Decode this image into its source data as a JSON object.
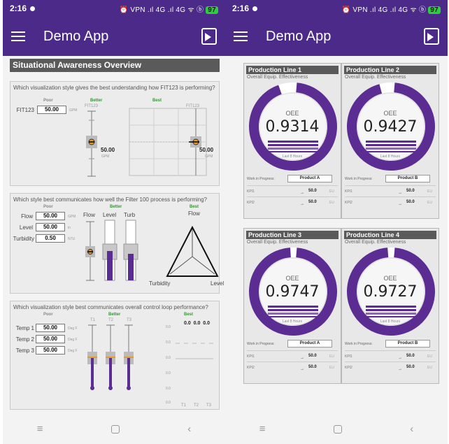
{
  "status": {
    "time": "2:16",
    "icons": "⏰ VPN .ıl 4G .ıl 4G ᯤ ⓑ",
    "battery": "97"
  },
  "app": {
    "title": "Demo App"
  },
  "left": {
    "header": "Situational Awareness Overview",
    "section1": {
      "question": "Which visualization style gives the best understanding how FIT123 is performing?",
      "poor": "Poor",
      "better": "Better",
      "best": "Best",
      "label": "FIT123",
      "value": "50.00",
      "unit": "GPM",
      "tag_better": "FIT123",
      "tag_best": "FIT123",
      "big_value": "50.00",
      "big_unit": "GPM",
      "best_value": "50.00",
      "best_unit": "GPM"
    },
    "section2": {
      "question": "Which style best communicates how well the Filter 100 process is performing?",
      "poor": "Poor",
      "better": "Better",
      "best": "Best",
      "flow_label": "Flow",
      "flow_value": "50.00",
      "flow_unit": "GPM",
      "level_label": "Level",
      "level_value": "50.00",
      "level_unit": "in",
      "turb_label": "Turbidity",
      "turb_value": "0.50",
      "turb_unit": "NTU",
      "col_flow": "Flow",
      "col_level": "Level",
      "col_turb": "Turb",
      "radar_top": "Flow",
      "radar_left": "Turbidity",
      "radar_right": "Level"
    },
    "section3": {
      "question": "Which visualization style best communicates overall control loop performance?",
      "poor": "Poor",
      "better": "Better",
      "best": "Best",
      "t1_label": "Temp 1",
      "t1_value": "50.00",
      "t2_label": "Temp 2",
      "t2_value": "50.00",
      "t3_label": "Temp 3",
      "t3_value": "50.00",
      "unit": "Deg F",
      "col_t1": "T1",
      "col_t2": "T2",
      "col_t3": "T3",
      "best_vals": "0.0  0.0  0.0",
      "axis_0": "0.0",
      "bottom_t1": "T1",
      "bottom_t2": "T2",
      "bottom_t3": "T3"
    }
  },
  "right": {
    "cards": [
      {
        "title": "Production Line 1",
        "subtitle": "Overall Equip. Effectiveness",
        "oee_label": "OEE",
        "oee_value": "0.9314",
        "period": "Last 8 Hours",
        "wip_label": "Work in Progress:",
        "wip_value": "Product A",
        "kpi1_label": "KPI1",
        "kpi1_value": "50.0",
        "kpi2_label": "KPI2",
        "kpi2_value": "50.0",
        "unit": "EU",
        "ratio": 0.9314
      },
      {
        "title": "Production Line 2",
        "subtitle": "Overall Equip. Effectiveness",
        "oee_label": "OEE",
        "oee_value": "0.9427",
        "period": "Last 8 Hours",
        "wip_label": "Work in Progress:",
        "wip_value": "Product B",
        "kpi1_label": "KPI1",
        "kpi1_value": "50.0",
        "kpi2_label": "KPI2",
        "kpi2_value": "50.0",
        "unit": "EU",
        "ratio": 0.9427
      },
      {
        "title": "Production Line 3",
        "subtitle": "Overall Equip. Effectiveness",
        "oee_label": "OEE",
        "oee_value": "0.9747",
        "period": "Last 8 Hours",
        "wip_label": "Work in Progress:",
        "wip_value": "Product A",
        "kpi1_label": "KPI1",
        "kpi1_value": "50.0",
        "kpi2_label": "KPI2",
        "kpi2_value": "50.0",
        "unit": "EU",
        "ratio": 0.9747
      },
      {
        "title": "Production Line 4",
        "subtitle": "Overall Equip. Effectiveness",
        "oee_label": "OEE",
        "oee_value": "0.9727",
        "period": "Last 8 Hours",
        "wip_label": "Work in Progress:",
        "wip_value": "Product B",
        "kpi1_label": "KPI1",
        "kpi1_value": "50.0",
        "kpi2_label": "KPI2",
        "kpi2_value": "50.0",
        "unit": "EU",
        "ratio": 0.9727
      }
    ]
  },
  "nav": {
    "menu_icon": "recent-apps-icon",
    "home_icon": "home-icon",
    "back_icon": "back-icon",
    "menu_glyph": "≡",
    "back_glyph": "‹"
  },
  "colors": {
    "primary": "#4b2a8a",
    "accent": "#6a3aa8",
    "good": "#2a9d2a"
  }
}
